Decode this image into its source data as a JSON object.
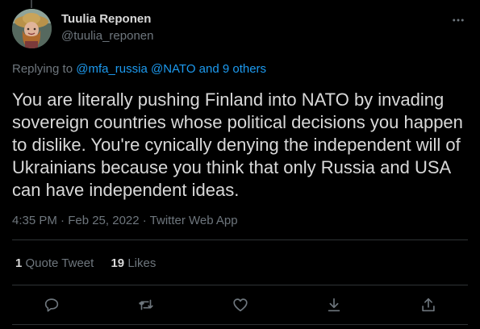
{
  "author": {
    "display_name": "Tuulia Reponen",
    "handle": "@tuulia_reponen"
  },
  "reply_context": {
    "prefix": "Replying to",
    "mentions": "@mfa_russia @NATO and 9 others"
  },
  "tweet": {
    "text": "You are literally pushing Finland into NATO by invading sovereign countries whose political decisions you happen to dislike. You're cynically denying the independent will of Ukrainians because you think that only Russia and USA can have independent ideas.",
    "timestamp": "4:35 PM · Feb 25, 2022 · Twitter Web App"
  },
  "stats": {
    "quote_count": "1",
    "quote_label": "Quote Tweet",
    "like_count": "19",
    "like_label": "Likes"
  },
  "icons": {
    "more": "more-horizontal-icon",
    "reply": "reply-icon",
    "retweet": "retweet-icon",
    "like": "heart-icon",
    "bookmark": "download-icon",
    "share": "share-icon"
  },
  "colors": {
    "background": "#000000",
    "text": "#d9d9d9",
    "secondary": "#6e767d",
    "accent": "#1d9bf0",
    "divider": "#2f3336"
  }
}
